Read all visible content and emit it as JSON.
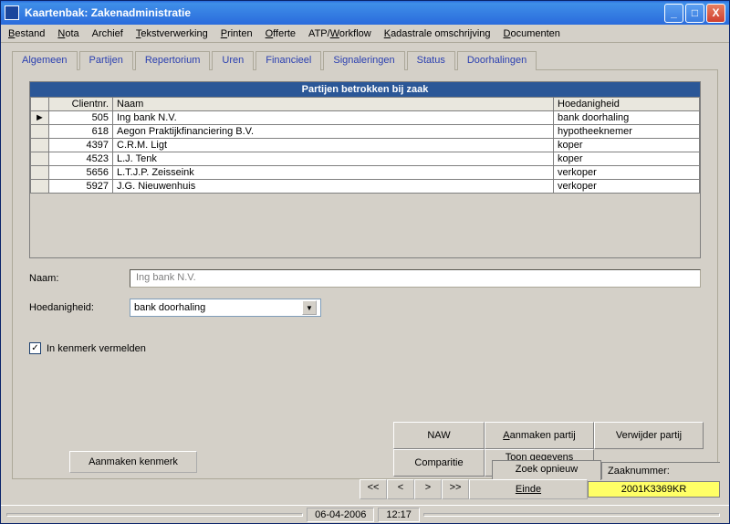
{
  "window": {
    "title": "Kaartenbak: Zakenadministratie"
  },
  "menu": {
    "bestand": "Bestand",
    "nota": "Nota",
    "archief": "Archief",
    "tekstverwerking": "Tekstverwerking",
    "printen": "Printen",
    "offerte": "Offerte",
    "atpw": "ATP/Workflow",
    "kadastrale": "Kadastrale omschrijving",
    "documenten": "Documenten"
  },
  "tabs": {
    "algemeen": "Algemeen",
    "partijen": "Partijen",
    "repertorium": "Repertorium",
    "uren": "Uren",
    "financieel": "Financieel",
    "signaleringen": "Signaleringen",
    "status": "Status",
    "doorhalingen": "Doorhalingen"
  },
  "grid": {
    "title": "Partijen betrokken bij zaak",
    "cols": {
      "client": "Clientnr.",
      "naam": "Naam",
      "hoed": "Hoedanigheid"
    },
    "rows": [
      {
        "marker": "►",
        "client": "505",
        "naam": "Ing bank N.V.",
        "hoed": "bank doorhaling"
      },
      {
        "marker": "",
        "client": "618",
        "naam": "Aegon Praktijkfinanciering B.V.",
        "hoed": "hypotheeknemer"
      },
      {
        "marker": "",
        "client": "4397",
        "naam": "C.R.M. Ligt",
        "hoed": "koper"
      },
      {
        "marker": "",
        "client": "4523",
        "naam": "L.J. Tenk",
        "hoed": "koper"
      },
      {
        "marker": "",
        "client": "5656",
        "naam": "L.T.J.P. Zeisseink",
        "hoed": "verkoper"
      },
      {
        "marker": "",
        "client": "5927",
        "naam": "J.G. Nieuwenhuis",
        "hoed": "verkoper"
      }
    ]
  },
  "form": {
    "naam_label": "Naam:",
    "naam_value": "Ing bank N.V.",
    "hoed_label": "Hoedanigheid:",
    "hoed_value": "bank doorhaling",
    "checkbox_label": "In kenmerk vermelden",
    "checkbox_mark": "✓",
    "aanmaken_kenmerk": "Aanmaken kenmerk"
  },
  "buttons": {
    "naw": "NAW",
    "aanmaken_partij": "Aanmaken partij",
    "verwijder_partij": "Verwijder partij",
    "comparitie": "Comparitie",
    "toon_client": "Toon gegevens cliënt"
  },
  "footer": {
    "zoek": "Zoek opnieuw",
    "zaaknr_label": "Zaaknummer:",
    "first": "<<",
    "prev": "<",
    "next": ">",
    "last": ">>",
    "einde": "Einde",
    "zaaknr_value": "2001K3369KR"
  },
  "status": {
    "date": "06-04-2006",
    "time": "12:17"
  }
}
